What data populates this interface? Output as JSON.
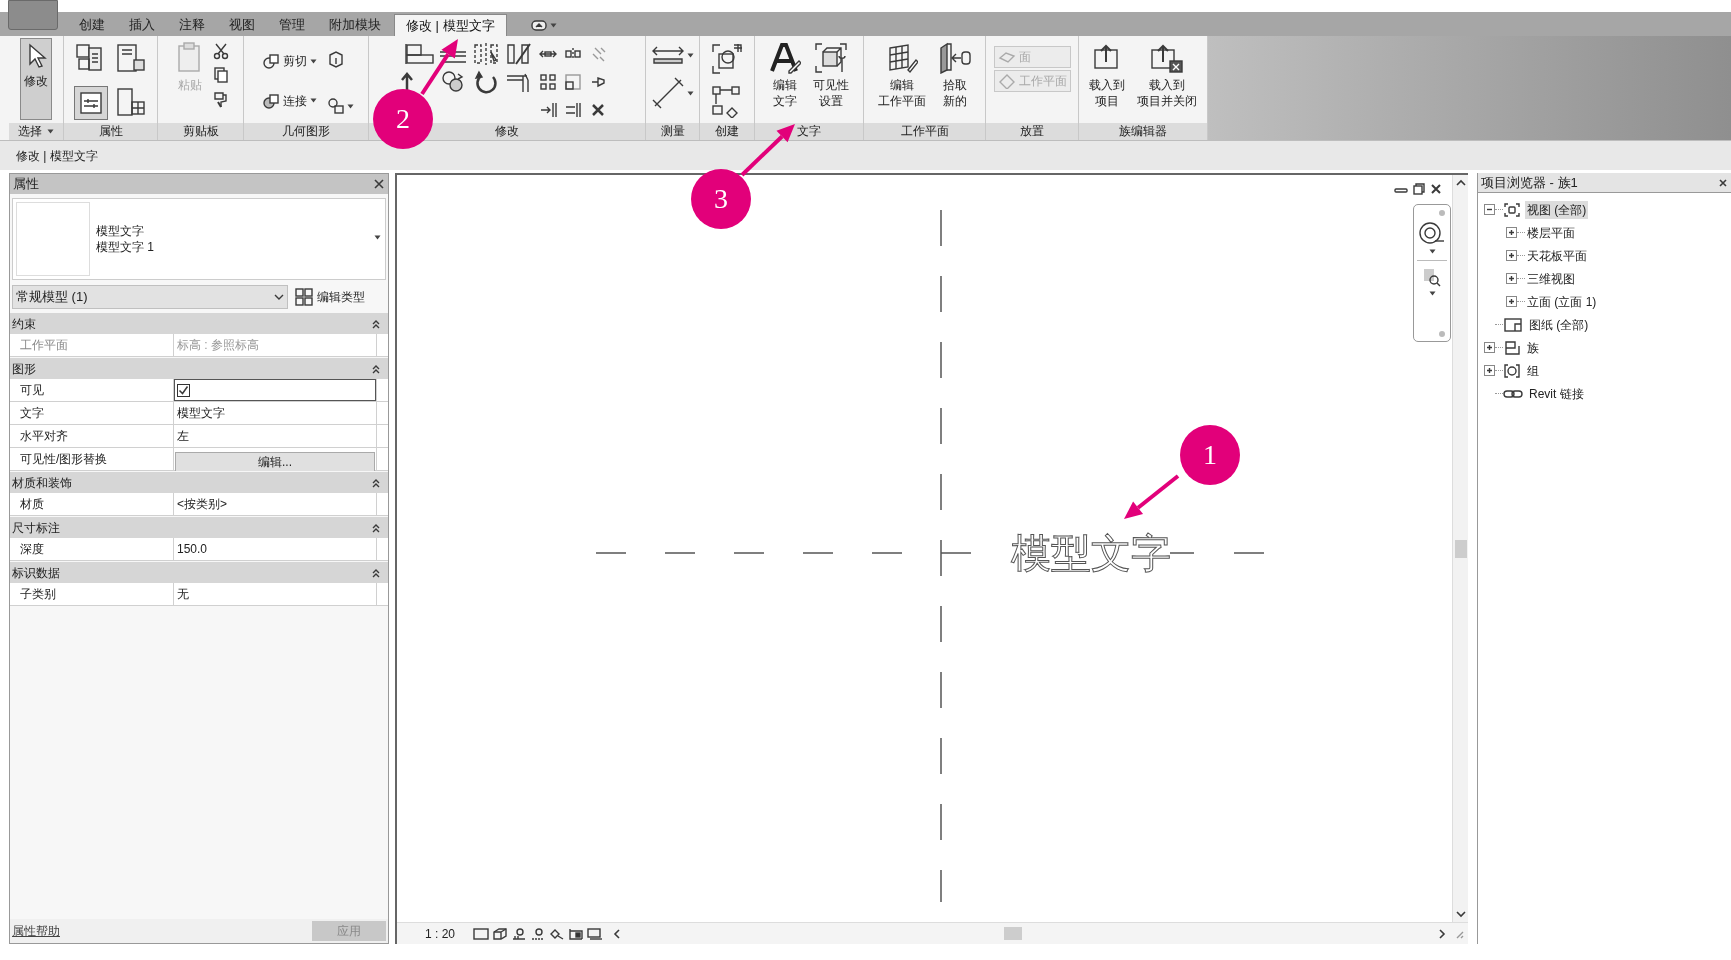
{
  "tabs": [
    {
      "label": "创建",
      "selected": false
    },
    {
      "label": "插入",
      "selected": false
    },
    {
      "label": "注释",
      "selected": false
    },
    {
      "label": "视图",
      "selected": false
    },
    {
      "label": "管理",
      "selected": false
    },
    {
      "label": "附加模块",
      "selected": false
    },
    {
      "label": "修改 | 模型文字",
      "selected": true
    }
  ],
  "ribbon": {
    "panels": [
      {
        "label": "选择",
        "dropdown": true,
        "buttons": [
          {
            "kind": "large",
            "lines": [
              "修改"
            ],
            "selected": true,
            "disabled": false
          }
        ]
      },
      {
        "label": "属性",
        "dropdown": false
      },
      {
        "label": "剪贴板",
        "dropdown": false,
        "buttons": [
          {
            "kind": "large",
            "lines": [
              "粘贴"
            ],
            "selected": false,
            "disabled": true
          }
        ]
      },
      {
        "label": "几何图形",
        "dropdown": false,
        "buttons": [
          {
            "kind": "small",
            "label": "剪切",
            "dropdown": true,
            "disabled": false
          },
          {
            "kind": "small",
            "label": "连接",
            "dropdown": true,
            "disabled": false
          }
        ]
      },
      {
        "label": "修改",
        "dropdown": false
      },
      {
        "label": "测量",
        "dropdown": false
      },
      {
        "label": "创建",
        "dropdown": false
      },
      {
        "label": "文字",
        "dropdown": false,
        "buttons": [
          {
            "kind": "large",
            "lines": [
              "编辑",
              "文字"
            ],
            "selected": false,
            "disabled": false
          },
          {
            "kind": "large",
            "lines": [
              "可见性",
              "设置"
            ],
            "selected": false,
            "disabled": false
          }
        ]
      },
      {
        "label": "工作平面",
        "dropdown": false,
        "buttons": [
          {
            "kind": "large",
            "lines": [
              "编辑",
              "工作平面"
            ],
            "selected": false,
            "disabled": false
          },
          {
            "kind": "large",
            "lines": [
              "拾取",
              "新的"
            ],
            "selected": false,
            "disabled": false
          }
        ]
      },
      {
        "label": "放置",
        "dropdown": false,
        "buttons": [
          {
            "kind": "small",
            "label": "面",
            "dropdown": false,
            "disabled": true
          },
          {
            "kind": "small",
            "label": "工作平面",
            "dropdown": false,
            "disabled": true
          }
        ]
      },
      {
        "label": "族编辑器",
        "dropdown": false,
        "buttons": [
          {
            "kind": "large",
            "lines": [
              "载入到",
              "项目"
            ],
            "selected": false,
            "disabled": false
          },
          {
            "kind": "large",
            "lines": [
              "载入到",
              "项目并关闭"
            ],
            "selected": false,
            "disabled": false
          }
        ]
      }
    ]
  },
  "context_bar": {
    "label": "修改 | 模型文字"
  },
  "properties": {
    "title": "属性",
    "type_selector": {
      "family": "模型文字",
      "type": "模型文字 1"
    },
    "filter": {
      "value": "常规模型 (1)"
    },
    "edit_type_button": "编辑类型",
    "groups": [
      {
        "label": "约束",
        "expanded": true,
        "rows": [
          {
            "kind": "readonly",
            "label": "工作平面",
            "value": "标高 : 参照标高"
          }
        ]
      },
      {
        "label": "图形",
        "expanded": true,
        "rows": [
          {
            "kind": "checkbox",
            "label": "可见",
            "checked": true
          },
          {
            "kind": "text",
            "label": "文字",
            "value": "模型文字"
          },
          {
            "kind": "text",
            "label": "水平对齐",
            "value": "左"
          },
          {
            "kind": "button",
            "label": "可见性/图形替换",
            "value": "编辑..."
          }
        ]
      },
      {
        "label": "材质和装饰",
        "expanded": true,
        "rows": [
          {
            "kind": "text",
            "label": "材质",
            "value": "<按类别>"
          }
        ]
      },
      {
        "label": "尺寸标注",
        "expanded": true,
        "rows": [
          {
            "kind": "text",
            "label": "深度",
            "value": "150.0"
          }
        ]
      },
      {
        "label": "标识数据",
        "expanded": true,
        "rows": [
          {
            "kind": "text",
            "label": "子类别",
            "value": "无"
          }
        ]
      }
    ],
    "help_link": "属性帮助",
    "apply_button": {
      "label": "应用",
      "disabled": true
    }
  },
  "canvas": {
    "model_text": "模型文字",
    "view_scale": "1 : 20"
  },
  "project_browser": {
    "title": "项目浏览器 - 族1",
    "tree": [
      {
        "label": "视图 (全部)",
        "kind": "views",
        "expanded": true,
        "selected": true,
        "children": [
          {
            "label": "楼层平面",
            "expanded": false,
            "selected": false
          },
          {
            "label": "天花板平面",
            "expanded": false,
            "selected": false
          },
          {
            "label": "三维视图",
            "expanded": false,
            "selected": false
          },
          {
            "label": "立面 (立面 1)",
            "expanded": false,
            "selected": false
          }
        ]
      },
      {
        "label": "图纸 (全部)",
        "kind": "sheets",
        "selected": false
      },
      {
        "label": "族",
        "kind": "families",
        "expanded": false,
        "selected": false
      },
      {
        "label": "组",
        "kind": "groups",
        "expanded": false,
        "selected": false
      },
      {
        "label": "Revit 链接",
        "kind": "links",
        "selected": false
      }
    ]
  },
  "callouts": [
    {
      "label": "1"
    },
    {
      "label": "2"
    },
    {
      "label": "3"
    }
  ]
}
